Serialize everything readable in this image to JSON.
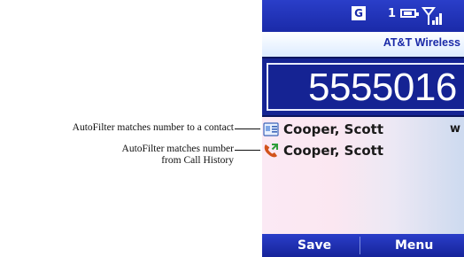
{
  "annotations": [
    {
      "line1": "AutoFilter matches number to a contact",
      "line2": ""
    },
    {
      "line1": "AutoFilter matches number",
      "line2": "from Call History"
    }
  ],
  "status_bar": {
    "network_badge": "G",
    "message_count": "1",
    "icons": [
      "battery-icon",
      "signal-icon"
    ]
  },
  "carrier": "AT&T Wireless",
  "dialer": {
    "number": "5555016"
  },
  "matches": [
    {
      "name": "Cooper, Scott",
      "type": "w",
      "icon": "contact-card-icon"
    },
    {
      "name": "Cooper, Scott",
      "type": "",
      "icon": "call-history-icon"
    }
  ],
  "softkeys": {
    "left": "Save",
    "right": "Menu"
  },
  "colors": {
    "bar_blue": "#1a2aa8",
    "dial_blue": "#152393",
    "text_dark": "#1a1a1a"
  }
}
